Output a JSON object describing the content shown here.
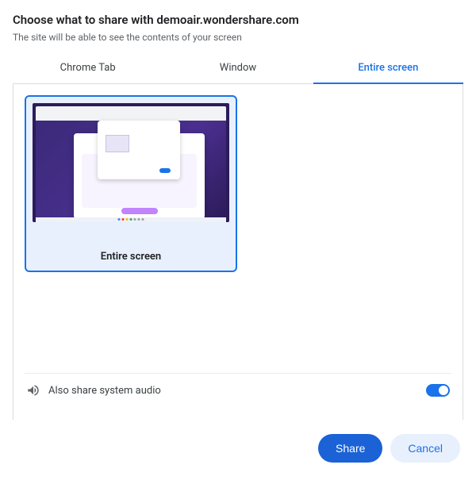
{
  "title": "Choose what to share with demoair.wondershare.com",
  "subtitle": "The site will be able to see the contents of your screen",
  "tabs": {
    "chrome_tab": "Chrome Tab",
    "window": "Window",
    "entire_screen": "Entire screen"
  },
  "active_tab": "entire_screen",
  "screens": [
    {
      "label": "Entire screen",
      "selected": true
    }
  ],
  "audio": {
    "label": "Also share system audio",
    "enabled": true
  },
  "buttons": {
    "share": "Share",
    "cancel": "Cancel"
  }
}
